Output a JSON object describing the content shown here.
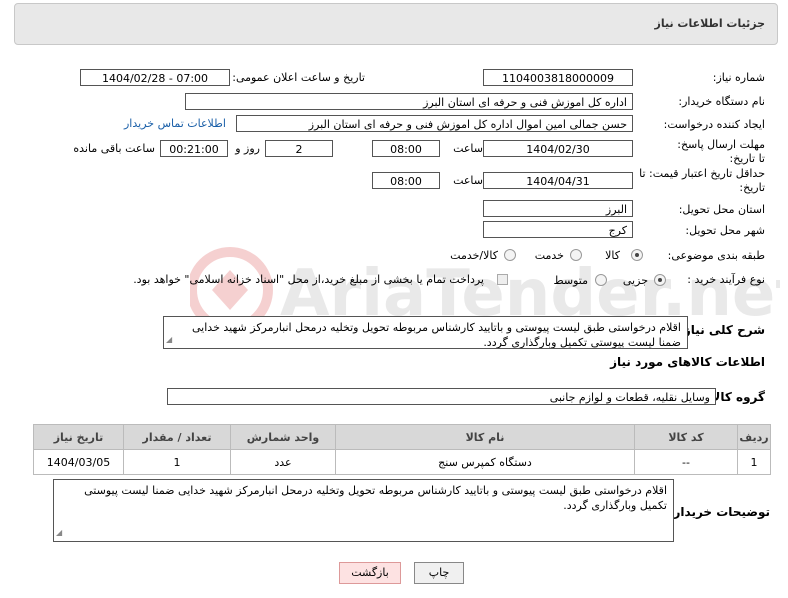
{
  "header": {
    "title": "جزئیات اطلاعات نیاز"
  },
  "form": {
    "need_number": {
      "label": "شماره نیاز:",
      "value": "1104003818000009"
    },
    "announce": {
      "label": "تاریخ و ساعت اعلان عمومی:",
      "value": "1404/02/28 - 07:00"
    },
    "buyer": {
      "label": "نام دستگاه خریدار:",
      "value": "اداره کل اموزش فنی و حرفه ای استان البرز"
    },
    "creator": {
      "label": "ایجاد کننده درخواست:",
      "value": "حسن جمالی امین اموال اداره کل اموزش فنی و حرفه ای استان البرز",
      "contact_link": "اطلاعات تماس خریدار"
    },
    "reply_deadline": {
      "label": "مهلت ارسال پاسخ: تا تاریخ:",
      "date": "1404/02/30",
      "time_label": "ساعت",
      "time": "08:00",
      "days": "2",
      "days_label": "روز و",
      "remaining": "00:21:00",
      "remaining_label": "ساعت باقی مانده"
    },
    "price_validity": {
      "label": "حداقل تاریخ اعتبار قیمت: تا تاریخ:",
      "date": "1404/04/31",
      "time_label": "ساعت",
      "time": "08:00"
    },
    "province": {
      "label": "استان محل تحویل:",
      "value": "البرز"
    },
    "city": {
      "label": "شهر محل تحویل:",
      "value": "کرج"
    },
    "category": {
      "label": "طبقه بندی موضوعی:",
      "options": [
        "کالا",
        "خدمت",
        "کالا/خدمت"
      ]
    },
    "purchase_type": {
      "label": "نوع فرآیند خرید :",
      "options": [
        "جزیی",
        "متوسط"
      ],
      "note": "پرداخت تمام یا بخشی از مبلغ خرید،از محل \"اسناد خزانه اسلامی\" خواهد بود."
    }
  },
  "description": {
    "label": "شرح کلی نیاز:",
    "text": "اقلام درخواستی طبق لیست پیوستی و باتایید کارشناس مربوطه تحویل وتخلیه درمحل انبارمرکز شهید خدایی ضمنا لیست پیوستی تکمیل وبارگذاری گردد."
  },
  "goods_section": {
    "title": "اطلاعات کالاهای مورد نیاز",
    "group_label": "گروه کالا:",
    "group_value": "وسایل نقلیه، قطعات و لوازم جانبی"
  },
  "table": {
    "headers": [
      "ردیف",
      "کد کالا",
      "نام کالا",
      "واحد شمارش",
      "تعداد / مقدار",
      "تاریخ نیاز"
    ],
    "rows": [
      [
        "1",
        "--",
        "دستگاه کمپرس سنج",
        "عدد",
        "1",
        "1404/03/05"
      ]
    ]
  },
  "buyer_notes": {
    "label": "توضیحات خریدار:",
    "text": "اقلام درخواستی طبق لیست پیوستی و باتایید کارشناس مربوطه تحویل وتخلیه درمحل انبارمرکز شهید خدایی ضمنا لیست پیوستی تکمیل وبارگذاری گردد."
  },
  "buttons": {
    "print": "چاپ",
    "back": "بازگشت"
  },
  "watermark": {
    "text": "AriaTender.net"
  }
}
